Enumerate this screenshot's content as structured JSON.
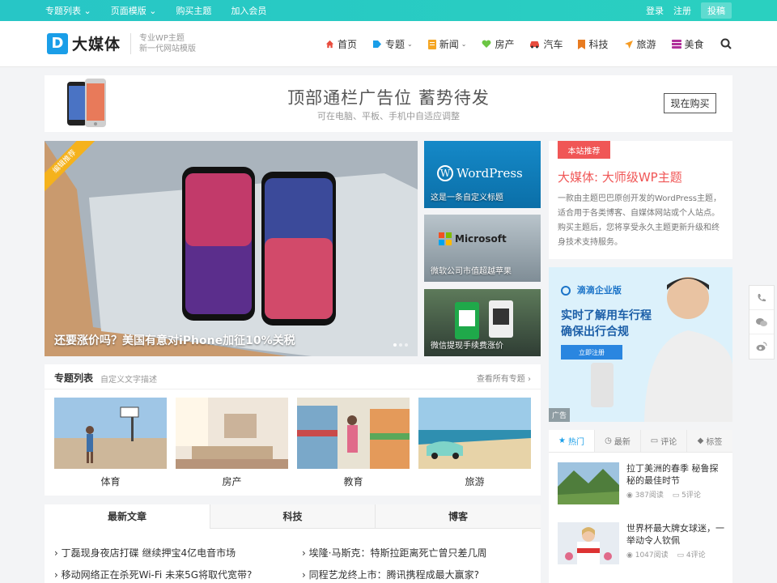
{
  "topbar": {
    "left": [
      "专题列表 ⌄",
      "页面模版 ⌄",
      "购买主题",
      "加入会员"
    ],
    "login": "登录",
    "register": "注册",
    "submit": "投稿"
  },
  "logo": {
    "letter": "D",
    "name": "大媒体",
    "slogan1": "专业WP主题",
    "slogan2": "新一代网站模版"
  },
  "nav": [
    {
      "label": "首页",
      "color": "#e84c3d"
    },
    {
      "label": "专题",
      "color": "#1a9ee8",
      "caret": true
    },
    {
      "label": "新闻",
      "color": "#f5a623",
      "caret": true
    },
    {
      "label": "房产",
      "color": "#6cc644"
    },
    {
      "label": "汽车",
      "color": "#e84c3d"
    },
    {
      "label": "科技",
      "color": "#e87b20"
    },
    {
      "label": "旅游",
      "color": "#f59b23"
    },
    {
      "label": "美食",
      "color": "#b0309a"
    }
  ],
  "ad_banner": {
    "title": "顶部通栏广告位 蓄势待发",
    "subtitle": "可在电脑、平板、手机中自适应调整",
    "button": "现在购买"
  },
  "slider": {
    "ribbon": "编辑推荐",
    "caption": "还要涨价吗？美国有意对iPhone加征10%关税"
  },
  "thumbs": [
    {
      "caption": "这是一条自定义标题",
      "logo": "WordPress"
    },
    {
      "caption": "微软公司市值超越苹果",
      "logo": "Microsoft"
    },
    {
      "caption": "微信提现手续费涨价"
    }
  ],
  "recommend": {
    "badge": "本站推荐",
    "title": "大媒体: 大师级WP主题",
    "desc": "一款由主题巴巴原创开发的WordPress主题，适合用于各类博客、自媒体网站或个人站点。购买主题后，您将享受永久主题更新升级和终身技术支持服务。"
  },
  "side_ad": {
    "brand": "滴滴企业版",
    "headline1": "实时了解用车行程",
    "headline2": "确保出行合规",
    "button": "立即注册",
    "tag": "广告"
  },
  "topics": {
    "title": "专题列表",
    "subtitle": "自定义文字描述",
    "more": "查看所有专题 ›",
    "items": [
      "体育",
      "房产",
      "教育",
      "旅游"
    ]
  },
  "article_tabs": {
    "tabs": [
      "最新文章",
      "科技",
      "博客"
    ],
    "articles": [
      "丁磊现身夜店打碟 继续押宝4亿电音市场",
      "埃隆·马斯克：特斯拉距离死亡曾只差几周",
      "移动网络正在杀死Wi-Fi 未来5G将取代宽带?",
      "同程艺龙终上市：腾讯携程成最大赢家?"
    ]
  },
  "hot": {
    "tabs": [
      "热门",
      "最新",
      "评论",
      "标签"
    ],
    "items": [
      {
        "title": "拉丁美洲的春季 秘鲁探秘的最佳时节",
        "views": "387阅读",
        "comments": "5评论"
      },
      {
        "title": "世界杯最大牌女球迷，一举动令人钦佩",
        "views": "1047阅读",
        "comments": "4评论"
      }
    ]
  }
}
